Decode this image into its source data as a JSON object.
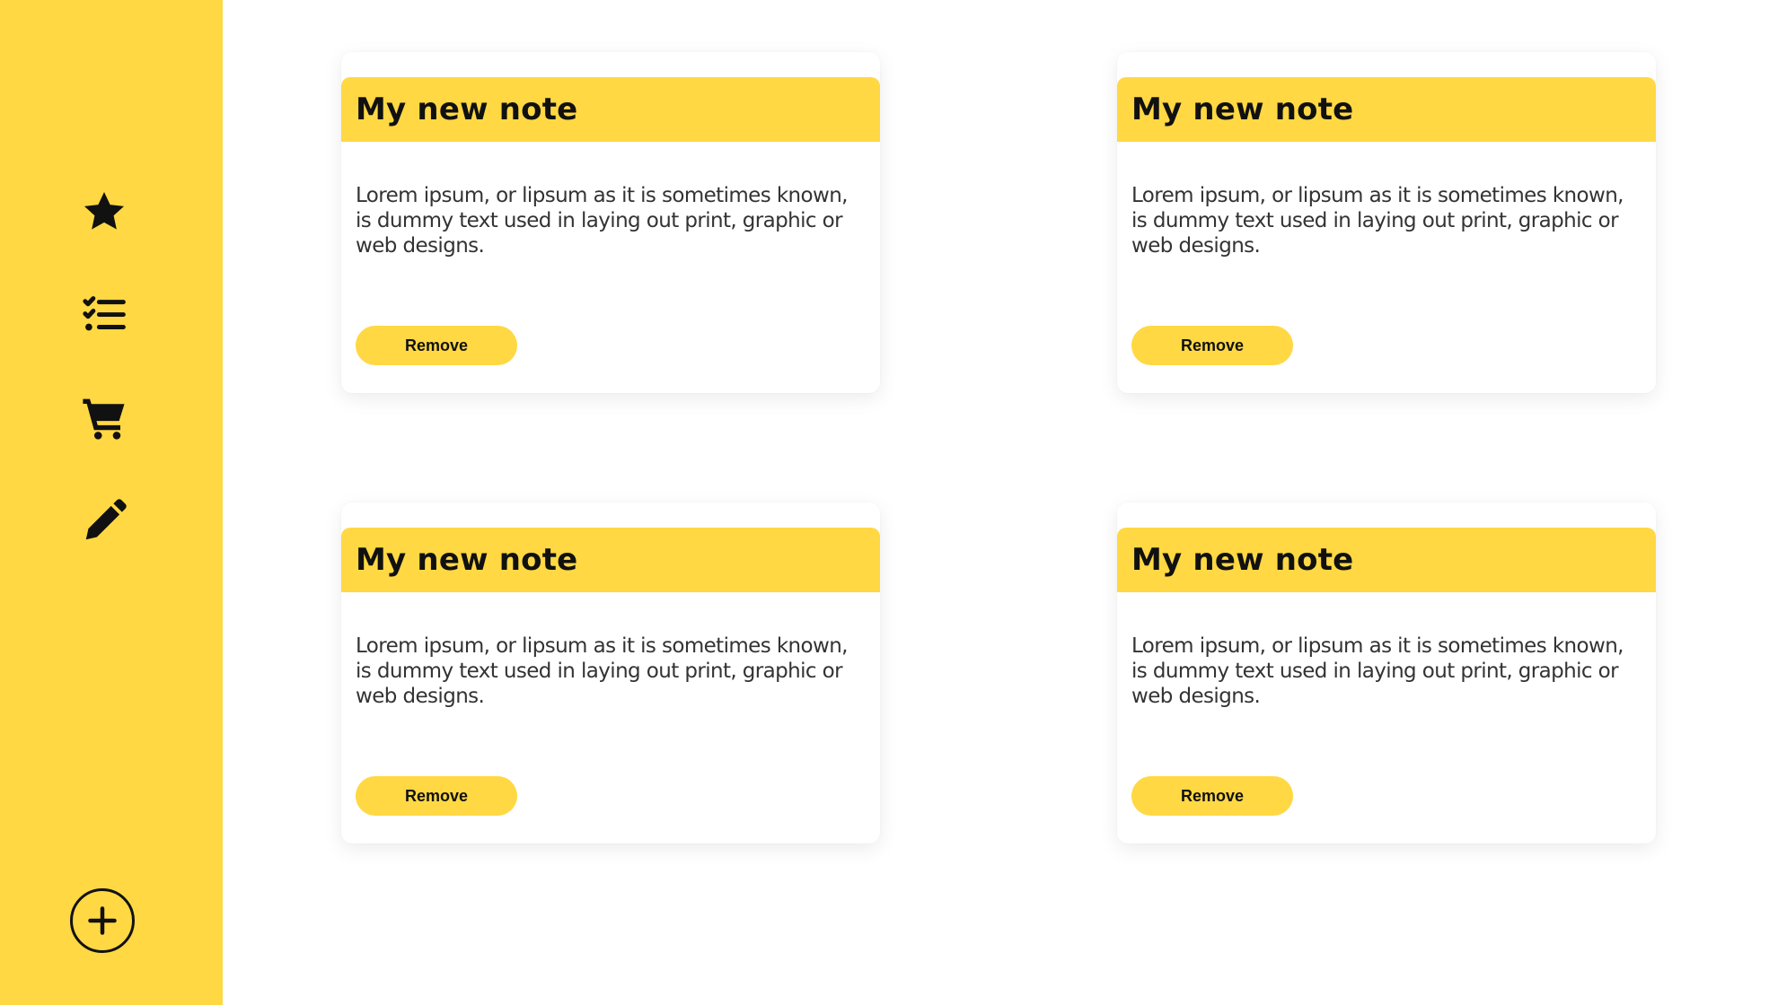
{
  "colors": {
    "accent": "#FFD843",
    "icon": "#111111",
    "background": "#FFFFFF"
  },
  "sidebar": {
    "items": [
      {
        "name": "favorites",
        "icon": "star-icon"
      },
      {
        "name": "todo-list",
        "icon": "checklist-icon"
      },
      {
        "name": "shopping",
        "icon": "cart-icon"
      },
      {
        "name": "edit",
        "icon": "pencil-icon"
      }
    ],
    "add_button": {
      "icon": "plus-circle-icon"
    }
  },
  "notes": [
    {
      "title": "My new note",
      "body": "Lorem ipsum, or lipsum as it is sometimes known, is dummy text used in laying out print, graphic or web designs.",
      "remove_label": "Remove"
    },
    {
      "title": "My new note",
      "body": "Lorem ipsum, or lipsum as it is sometimes known, is dummy text used in laying out print, graphic or web designs.",
      "remove_label": "Remove"
    },
    {
      "title": "My new note",
      "body": "Lorem ipsum, or lipsum as it is sometimes known, is dummy text used in laying out print, graphic or web designs.",
      "remove_label": "Remove"
    },
    {
      "title": "My new note",
      "body": "Lorem ipsum, or lipsum as it is sometimes known, is dummy text used in laying out print, graphic or web designs.",
      "remove_label": "Remove"
    }
  ]
}
